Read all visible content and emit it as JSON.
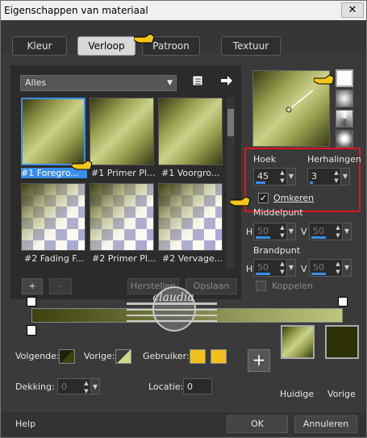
{
  "window": {
    "title": "Eigenschappen van materiaal",
    "close": "✕"
  },
  "tabs": [
    "Kleur",
    "Verloop",
    "Patroon",
    "Textuur"
  ],
  "active_tab": "Verloop",
  "category_dropdown": {
    "value": "Alles"
  },
  "thumbnails": [
    {
      "label": "#1 Foregro...",
      "selected": true
    },
    {
      "label": "#1 Primer Pl...",
      "selected": false
    },
    {
      "label": "#1 Voorgro...",
      "selected": false
    },
    {
      "label": "#2 Fading F...",
      "selected": false
    },
    {
      "label": "#2 Primer Pl...",
      "selected": false
    },
    {
      "label": "#2 Vervage...",
      "selected": false
    }
  ],
  "editor": {
    "add": "+",
    "remove": "-",
    "restore": "Herstellen",
    "save": "Opslaan"
  },
  "angle": {
    "label": "Hoek",
    "value": "45"
  },
  "repeats": {
    "label": "Herhalingen",
    "value": "3"
  },
  "invert": {
    "label": "Omkeren",
    "checked": true
  },
  "midpoint": {
    "label": "Middelpunt",
    "h_label": "H",
    "h_value": "50",
    "v_label": "V",
    "v_value": "50"
  },
  "focal": {
    "label": "Brandpunt",
    "h_label": "H",
    "h_value": "50",
    "v_label": "V",
    "v_value": "50"
  },
  "link": {
    "label": "Koppelen",
    "checked": false
  },
  "watermark": {
    "text": "claudia"
  },
  "bottom": {
    "next_label": "Volgende:",
    "prev_label": "Vorige:",
    "user_label": "Gebruiker:",
    "opacity_label": "Dekking:",
    "opacity_value": "0",
    "location_label": "Locatie:",
    "location_value": "0",
    "current_label": "Huidige",
    "previous_label": "Vorige"
  },
  "colors": {
    "accent": "#3a8ee6",
    "highlight": "#e0141e",
    "user_swatch": "#f0c020",
    "prev_swatch": "#2e3008"
  },
  "footer": {
    "help": "Help",
    "ok": "OK",
    "cancel": "Annuleren"
  }
}
